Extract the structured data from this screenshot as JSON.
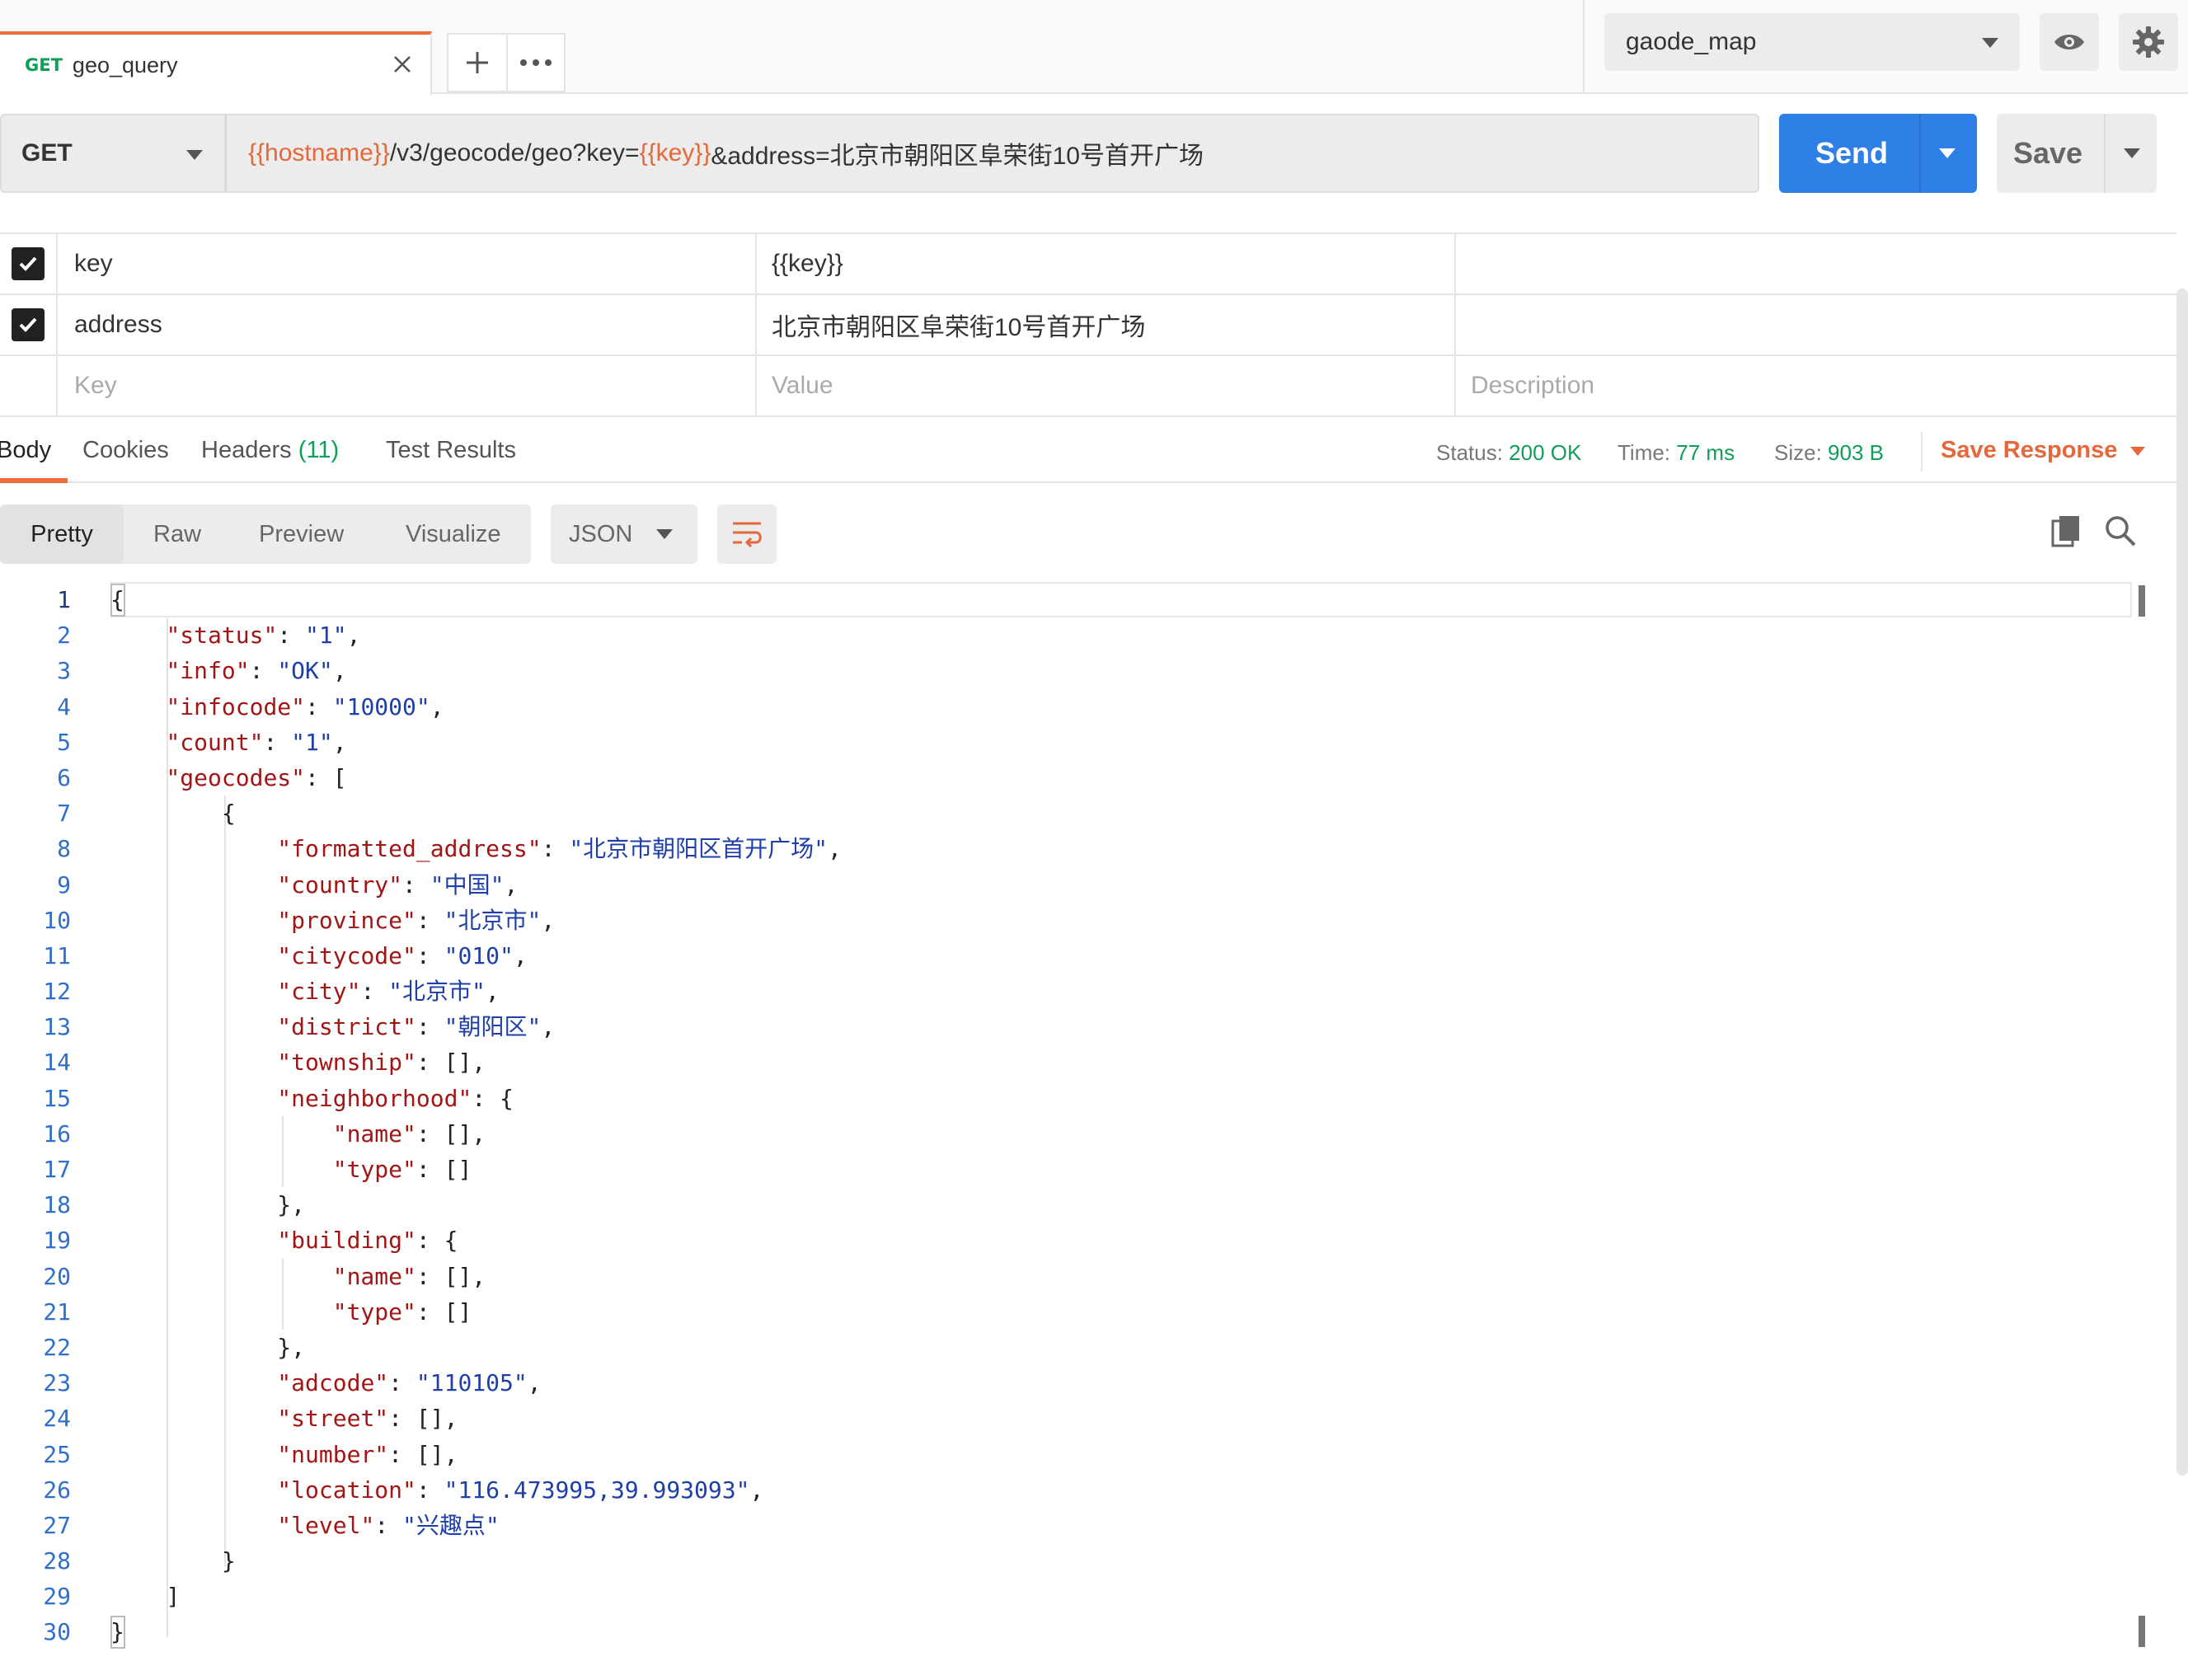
{
  "tab": {
    "method": "GET",
    "title": "geo_query"
  },
  "environment": {
    "selected": "gaode_map"
  },
  "request": {
    "method": "GET",
    "url": {
      "host_var": "{{hostname}}",
      "path": "/v3/geocode/geo?key=",
      "key_var": "{{key}}",
      "rest": "&address=北京市朝阳区阜荣街10号首开广场"
    },
    "send_label": "Send",
    "save_label": "Save"
  },
  "params": {
    "rows": [
      {
        "checked": true,
        "key": "key",
        "value": "{{key}}",
        "description": ""
      },
      {
        "checked": true,
        "key": "address",
        "value": "北京市朝阳区阜荣街10号首开广场",
        "description": ""
      }
    ],
    "placeholders": {
      "key": "Key",
      "value": "Value",
      "description": "Description"
    }
  },
  "response": {
    "tabs": {
      "body": "Body",
      "cookies": "Cookies",
      "headers": "Headers",
      "headers_count": "(11)",
      "tests": "Test Results"
    },
    "status_label": "Status:",
    "status": "200 OK",
    "time_label": "Time:",
    "time": "77 ms",
    "size_label": "Size:",
    "size": "903 B",
    "save_response": "Save Response"
  },
  "body_view": {
    "modes": [
      "Pretty",
      "Raw",
      "Preview",
      "Visualize"
    ],
    "active_mode": "Pretty",
    "format": "JSON"
  },
  "code_lines": [
    [
      [
        "p",
        "{"
      ]
    ],
    [
      [
        "i",
        "    "
      ],
      [
        "k",
        "\"status\""
      ],
      [
        "p",
        ": "
      ],
      [
        "s",
        "\"1\""
      ],
      [
        "p",
        ","
      ]
    ],
    [
      [
        "i",
        "    "
      ],
      [
        "k",
        "\"info\""
      ],
      [
        "p",
        ": "
      ],
      [
        "s",
        "\"OK\""
      ],
      [
        "p",
        ","
      ]
    ],
    [
      [
        "i",
        "    "
      ],
      [
        "k",
        "\"infocode\""
      ],
      [
        "p",
        ": "
      ],
      [
        "s",
        "\"10000\""
      ],
      [
        "p",
        ","
      ]
    ],
    [
      [
        "i",
        "    "
      ],
      [
        "k",
        "\"count\""
      ],
      [
        "p",
        ": "
      ],
      [
        "s",
        "\"1\""
      ],
      [
        "p",
        ","
      ]
    ],
    [
      [
        "i",
        "    "
      ],
      [
        "k",
        "\"geocodes\""
      ],
      [
        "p",
        ": ["
      ]
    ],
    [
      [
        "i",
        "        "
      ],
      [
        "p",
        "{"
      ]
    ],
    [
      [
        "i",
        "            "
      ],
      [
        "k",
        "\"formatted_address\""
      ],
      [
        "p",
        ": "
      ],
      [
        "s",
        "\"北京市朝阳区首开广场\""
      ],
      [
        "p",
        ","
      ]
    ],
    [
      [
        "i",
        "            "
      ],
      [
        "k",
        "\"country\""
      ],
      [
        "p",
        ": "
      ],
      [
        "s",
        "\"中国\""
      ],
      [
        "p",
        ","
      ]
    ],
    [
      [
        "i",
        "            "
      ],
      [
        "k",
        "\"province\""
      ],
      [
        "p",
        ": "
      ],
      [
        "s",
        "\"北京市\""
      ],
      [
        "p",
        ","
      ]
    ],
    [
      [
        "i",
        "            "
      ],
      [
        "k",
        "\"citycode\""
      ],
      [
        "p",
        ": "
      ],
      [
        "s",
        "\"010\""
      ],
      [
        "p",
        ","
      ]
    ],
    [
      [
        "i",
        "            "
      ],
      [
        "k",
        "\"city\""
      ],
      [
        "p",
        ": "
      ],
      [
        "s",
        "\"北京市\""
      ],
      [
        "p",
        ","
      ]
    ],
    [
      [
        "i",
        "            "
      ],
      [
        "k",
        "\"district\""
      ],
      [
        "p",
        ": "
      ],
      [
        "s",
        "\"朝阳区\""
      ],
      [
        "p",
        ","
      ]
    ],
    [
      [
        "i",
        "            "
      ],
      [
        "k",
        "\"township\""
      ],
      [
        "p",
        ": [],"
      ]
    ],
    [
      [
        "i",
        "            "
      ],
      [
        "k",
        "\"neighborhood\""
      ],
      [
        "p",
        ": {"
      ]
    ],
    [
      [
        "i",
        "                "
      ],
      [
        "k",
        "\"name\""
      ],
      [
        "p",
        ": [],"
      ]
    ],
    [
      [
        "i",
        "                "
      ],
      [
        "k",
        "\"type\""
      ],
      [
        "p",
        ": []"
      ]
    ],
    [
      [
        "i",
        "            "
      ],
      [
        "p",
        "},"
      ]
    ],
    [
      [
        "i",
        "            "
      ],
      [
        "k",
        "\"building\""
      ],
      [
        "p",
        ": {"
      ]
    ],
    [
      [
        "i",
        "                "
      ],
      [
        "k",
        "\"name\""
      ],
      [
        "p",
        ": [],"
      ]
    ],
    [
      [
        "i",
        "                "
      ],
      [
        "k",
        "\"type\""
      ],
      [
        "p",
        ": []"
      ]
    ],
    [
      [
        "i",
        "            "
      ],
      [
        "p",
        "},"
      ]
    ],
    [
      [
        "i",
        "            "
      ],
      [
        "k",
        "\"adcode\""
      ],
      [
        "p",
        ": "
      ],
      [
        "s",
        "\"110105\""
      ],
      [
        "p",
        ","
      ]
    ],
    [
      [
        "i",
        "            "
      ],
      [
        "k",
        "\"street\""
      ],
      [
        "p",
        ": [],"
      ]
    ],
    [
      [
        "i",
        "            "
      ],
      [
        "k",
        "\"number\""
      ],
      [
        "p",
        ": [],"
      ]
    ],
    [
      [
        "i",
        "            "
      ],
      [
        "k",
        "\"location\""
      ],
      [
        "p",
        ": "
      ],
      [
        "s",
        "\"116.473995,39.993093\""
      ],
      [
        "p",
        ","
      ]
    ],
    [
      [
        "i",
        "            "
      ],
      [
        "k",
        "\"level\""
      ],
      [
        "p",
        ": "
      ],
      [
        "s",
        "\"兴趣点\""
      ]
    ],
    [
      [
        "i",
        "        "
      ],
      [
        "p",
        "}"
      ]
    ],
    [
      [
        "i",
        "    "
      ],
      [
        "p",
        "]"
      ]
    ],
    [
      [
        "p",
        "}"
      ]
    ]
  ],
  "colors": {
    "accent": "#f26b3a",
    "variable": "#e5683a",
    "send": "#2e7fe6",
    "success": "#0f9d58",
    "json_key": "#a31515",
    "json_string": "#1f3fa8"
  }
}
